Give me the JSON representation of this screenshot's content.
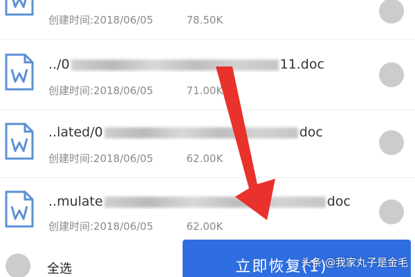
{
  "accent_color": "#2f6ee0",
  "arrow_color": "#e8322b",
  "files": [
    {
      "name_prefix": "",
      "name_suffix": "",
      "created": "创建时间:2018/06/05",
      "size": "78.50K",
      "icon": "word-doc-icon"
    },
    {
      "name_prefix": "../0",
      "name_suffix": "11.doc",
      "created": "创建时间:2018/06/05",
      "size": "71.00K",
      "icon": "word-doc-icon"
    },
    {
      "name_prefix": "..lated/0",
      "name_suffix": "doc",
      "created": "创建时间:2018/06/05",
      "size": "62.00K",
      "icon": "word-doc-icon"
    },
    {
      "name_prefix": "..mulate",
      "name_suffix": "doc",
      "created": "创建时间:2018/06/05",
      "size": "62.00K",
      "icon": "word-doc-icon"
    }
  ],
  "bottom": {
    "select_all_label": "全选",
    "restore_label": "立即恢复(1)"
  },
  "watermark": "头条 @我家丸子是金毛"
}
